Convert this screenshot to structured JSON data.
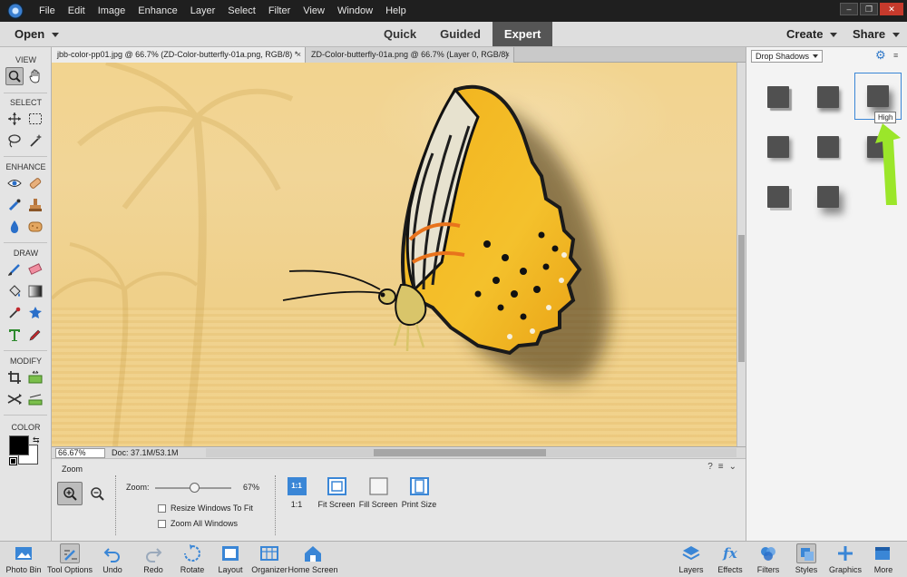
{
  "menu": [
    "File",
    "Edit",
    "Image",
    "Enhance",
    "Layer",
    "Select",
    "Filter",
    "View",
    "Window",
    "Help"
  ],
  "window_controls": [
    "–",
    "❐",
    "✕"
  ],
  "modebar": {
    "open_label": "Open",
    "tabs": [
      "Quick",
      "Guided",
      "Expert"
    ],
    "active_tab": "Expert",
    "create_label": "Create",
    "share_label": "Share"
  },
  "toolbox": {
    "sections": [
      "VIEW",
      "SELECT",
      "ENHANCE",
      "DRAW",
      "MODIFY",
      "COLOR"
    ]
  },
  "documents": {
    "tabs": [
      {
        "title": "jbb-color-pp01.jpg @ 66.7% (ZD-Color-butterfly-01a.png, RGB/8) *",
        "close": "×"
      },
      {
        "title": "ZD-Color-butterfly-01a.png @ 66.7% (Layer 0, RGB/8)",
        "close": "×"
      }
    ]
  },
  "status": {
    "zoom_percent": "66.67%",
    "doc_size": "Doc: 37.1M/53.1M"
  },
  "tool_options": {
    "title": "Zoom",
    "zoom_label": "Zoom:",
    "zoom_value": "67%",
    "zoom_fraction": 0.67,
    "resize_windows_label": "Resize Windows To Fit",
    "zoom_all_label": "Zoom All Windows",
    "view_buttons": [
      {
        "label": "1:1",
        "icon_text": "1:1"
      },
      {
        "label": "Fit Screen"
      },
      {
        "label": "Fill Screen"
      },
      {
        "label": "Print Size"
      }
    ],
    "help_icon": "?",
    "menu_icon": "≡",
    "collapse_icon": "⌄"
  },
  "right_panel": {
    "category": "Drop Shadows",
    "tooltip": "High",
    "swatch_count": 8
  },
  "bottombar": {
    "left": [
      "Photo Bin",
      "Tool Options",
      "Undo",
      "Redo",
      "Rotate",
      "Layout",
      "Organizer",
      "Home Screen"
    ],
    "right": [
      "Layers",
      "Effects",
      "Filters",
      "Styles",
      "Graphics",
      "More"
    ],
    "active_left": "Tool Options",
    "active_right": "Styles"
  },
  "colors": {
    "accent": "#3a86d6",
    "canvas_bg": "#f1d597",
    "arrow": "#9be62a"
  }
}
